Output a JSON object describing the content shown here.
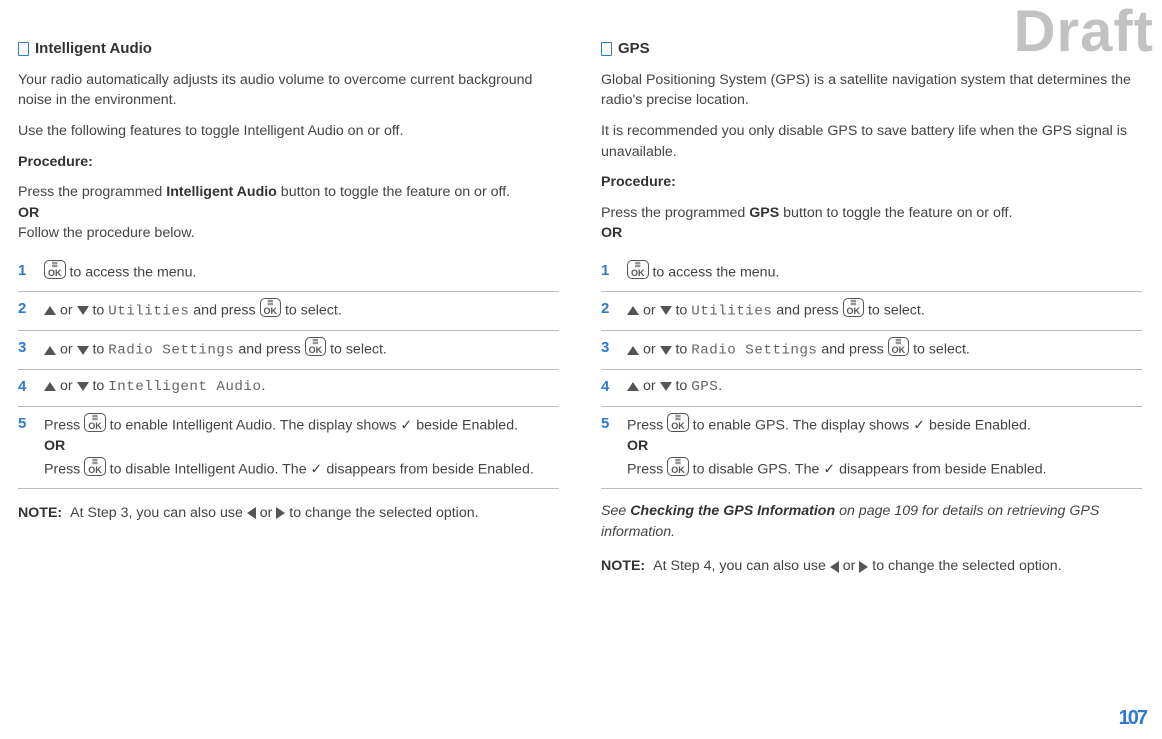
{
  "watermark": "Draft",
  "page_number": "107",
  "left": {
    "title": "Intelligent Audio",
    "intro1": "Your radio automatically adjusts its audio volume to overcome current background noise in the environment.",
    "intro2": "Use the following features to toggle Intelligent Audio on or off.",
    "procedure_label": "Procedure:",
    "proc_p1a": "Press the programmed ",
    "proc_p1b": "Intelligent Audio",
    "proc_p1c": " button to toggle the feature on or off.",
    "or": "OR",
    "proc_p2": "Follow the procedure below.",
    "step1_suffix": " to access the menu.",
    "step2_mid": " to ",
    "step2_target": "Utilities",
    "step2_and": " and press ",
    "step2_end": " to select.",
    "step3_target": "Radio Settings",
    "step3_end": " to select.",
    "step4_target": "Intelligent Audio",
    "step5_a": "Press ",
    "step5_b": " to enable Intelligent Audio. The display shows ✓ beside Enabled.",
    "step5_or": "OR",
    "step5_c": "Press ",
    "step5_d": " to disable Intelligent Audio. The ✓ disappears from beside Enabled.",
    "note_label": "NOTE:",
    "note_a": "At Step 3, you can also use ",
    "note_b": " or ",
    "note_c": " to change the selected option."
  },
  "right": {
    "title": "GPS",
    "intro1": "Global Positioning System (GPS) is a satellite navigation system that determines the radio's precise location.",
    "intro2": "It is recommended you only disable GPS to save battery life when the GPS signal is unavailable.",
    "procedure_label": "Procedure:",
    "proc_p1a": "Press the programmed ",
    "proc_p1b": "GPS",
    "proc_p1c": " button to toggle the feature on or off.",
    "or": "OR",
    "step1_suffix": " to access the menu.",
    "step2_mid": " to ",
    "step2_target": "Utilities",
    "step2_end": " to select.",
    "step3_target": "Radio Settings",
    "step3_end": " to select.",
    "step4_target": "GPS",
    "step5_a": "Press ",
    "step5_b": " to enable GPS. The display shows ✓ beside Enabled.",
    "step5_or": "OR",
    "step5_c": "Press ",
    "step5_d": " to disable GPS. The ✓ disappears from beside Enabled.",
    "see_a": "See ",
    "see_b": "Checking the GPS Information",
    "see_c": " on page 109 for details on retrieving GPS information.",
    "note_label": "NOTE:",
    "note_a": "At Step 4, you can also use ",
    "note_b": " or ",
    "note_c": " to change the selected option."
  },
  "ok_label": "OK",
  "or_word": " or ",
  "and_press": " and press ",
  "to_word": " to ",
  "period": "."
}
